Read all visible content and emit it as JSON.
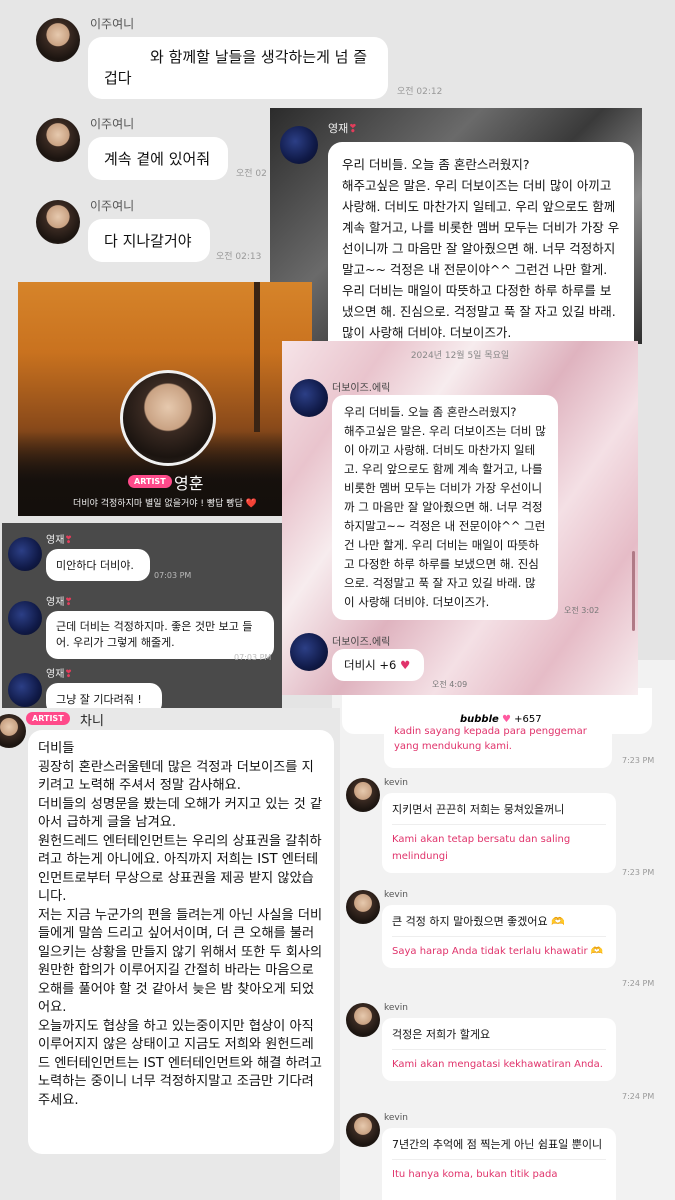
{
  "panel_top": {
    "messages": [
      {
        "sender": "이주여니",
        "text": "와 함께할 날들을 생각하는게 넘 즐\n겁다",
        "time": "오전 02:12"
      },
      {
        "sender": "이주여니",
        "text": "계속 곁에 있어줘",
        "time": "오전 02"
      },
      {
        "sender": "이주여니",
        "text": "다 지나갈거야",
        "time": "오전 02:13"
      }
    ]
  },
  "panel_dark": {
    "sender": "영재",
    "heart": "❣",
    "text": "우리 더비들. 오늘 좀 혼란스러웠지?\n해주고싶은 말은. 우리 더보이즈는 더비 많이 아끼고 사랑해. 더비도 마찬가지 일테고. 우리 앞으로도 함께 계속 할거고, 나를 비롯한 멤버 모두는 더비가 가장 우선이니까 그 마음만 잘 알아줬으면 해. 너무 걱정하지말고~~ 걱정은 내 전문이야^^ 그런건 나만 할게. 우리 더비는 매일이 따뜻하고 다정한 하루 하루를 보냈으면 해. 진심으로. 걱정말고 푹 잘 자고 있길 바래. 많이 사랑해 더비야. 더보이즈가."
  },
  "panel_sunset": {
    "badge": "ARTIST",
    "name": "영훈",
    "status": "더비야 걱정하지마 별일 없을거야 ! 빵답 빵답 ❤️"
  },
  "panel_pink": {
    "date": "2024년 12월 5일 목요일",
    "sender": "더보이즈.에릭",
    "text": "우리 더비들. 오늘 좀 혼란스러웠지?\n해주고싶은 말은. 우리 더보이즈는 더비 많이 아끼고 사랑해. 더비도 마찬가지 일테고. 우리 앞으로도 함께 계속 할거고, 나를 비롯한 멤버 모두는 더비가 가장 우선이니까 그 마음만 잘 알아줬으면 해. 너무 걱정하지말고~~ 걱정은 내 전문이야^^ 그런건 나만 할게. 우리 더비는 매일이 따뜻하고 다정한 하루 하루를 보냈으면 해. 진심으로. 걱정말고 푹 잘 자고 있길 바래. 많이 사랑해 더비야. 더보이즈가.",
    "time1": "오전 3:02",
    "sender2": "더보이즈.에릭",
    "text2": "더비시 +6",
    "time2": "오전 4:09"
  },
  "panel_small": {
    "messages": [
      {
        "sender": "영재",
        "heart": "❣",
        "text": "미안하다 더비야.",
        "time": "07:03 PM"
      },
      {
        "sender": "영재",
        "heart": "❣",
        "text": "근데 더비는 걱정하지마. 좋은 것만 보고 들어. 우리가 그렇게 해줄게.",
        "time": "07:03 PM"
      },
      {
        "sender": "영재",
        "heart": "❣",
        "text": "그냥 잘 기다려줘 !",
        "time": ""
      }
    ]
  },
  "panel_chani": {
    "badge": "ARTIST",
    "name": "차니",
    "text": "더비들\n굉장히 혼란스러울텐데 많은 걱정과 더보이즈를 지키려고 노력해 주셔서 정말 감사해요.\n더비들의 성명문을 봤는데 오해가 커지고 있는 것 같아서 급하게 글을 남겨요.\n원헌드레드 엔터테인먼트는 우리의 상표권을 갈취하려고 하는게 아니에요. 아직까지 저희는 IST 엔터테인먼트로부터 무상으로 상표권을 제공 받지 않았습니다.\n저는 지금 누군가의 편을 들려는게 아닌 사실을 더비들에게 말씀 드리고 싶어서이며, 더 큰 오해를 불러일으키는 상황을 만들지 않기 위해서 또한 두 회사의 원만한 합의가 이루어지길 간절히 바라는 마음으로 오해를 풀어야 할 것 같아서 늦은 밤 찾아오게 되었어요.\n오늘까지도 협상을 하고 있는중이지만 협상이 아직 이루어지지 않은 상태이고 지금도 저희와 원헌드레드 엔터테인먼트는 IST 엔터테인먼트와 해결 하려고 노력하는 중이니 너무 걱정하지말고 조금만 기다려주세요."
  },
  "panel_kevin": {
    "bubble_label": "bubble",
    "bubble_count": "+657",
    "top_partial_line1": "kadin sayang kepada para penggemar",
    "top_partial_line2": "yang mendukung kami.",
    "top_time": "7:23 PM",
    "messages": [
      {
        "sender": "kevin",
        "ko": "지키면서 끈끈히 저희는 뭉쳐있을꺼니",
        "id": "Kami akan tetap bersatu dan saling melindungi",
        "time": "7:23 PM"
      },
      {
        "sender": "kevin",
        "ko": "큰 걱정 하지 말아줬으면 좋겠어요 🫶",
        "id": "Saya harap Anda tidak terlalu khawatir 🫶",
        "time": "7:24 PM"
      },
      {
        "sender": "kevin",
        "ko": "걱정은 저희가 할게요",
        "id": "Kami akan mengatasi kekhawatiran Anda.",
        "time": "7:24 PM"
      },
      {
        "sender": "kevin",
        "ko": "7년간의 추억에 점 찍는게 아닌 쉼표일 뿐이니",
        "id": "Itu hanya koma, bukan titik pada",
        "time": ""
      }
    ]
  }
}
